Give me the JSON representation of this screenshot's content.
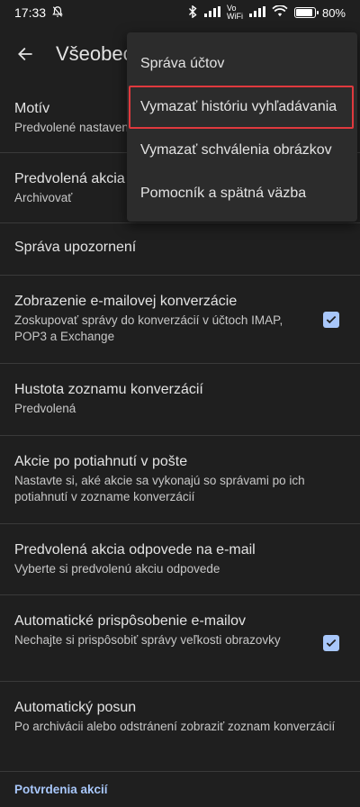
{
  "status_bar": {
    "time": "17:33",
    "network_top": "Vo",
    "network_bottom": "WiFi",
    "battery": "80%"
  },
  "header": {
    "title": "Všeobecné nastavenia"
  },
  "settings": [
    {
      "title": "Motív",
      "subtitle": "Predvolené nastavenie systému"
    },
    {
      "title": "Predvolená akcia upozornenia",
      "subtitle": "Archivovať"
    },
    {
      "title": "Správa upozornení"
    },
    {
      "title": "Zobrazenie e-mailovej konverzácie",
      "subtitle": "Zoskupovať správy do konverzácií v účtoch IMAP, POP3 a Exchange",
      "checked": true
    },
    {
      "title": "Hustota zoznamu konverzácií",
      "subtitle": "Predvolená"
    },
    {
      "title": "Akcie po potiahnutí v pošte",
      "subtitle": "Nastavte si, aké akcie sa vykonajú so správami po ich potiahnutí v zozname konverzácií"
    },
    {
      "title": "Predvolená akcia odpovede na e-mail",
      "subtitle": "Vyberte si predvolenú akciu odpovede"
    },
    {
      "title": "Automatické prispôsobenie e-mailov",
      "subtitle": "Nechajte si prispôsobiť správy veľkosti obrazovky",
      "checked": true
    },
    {
      "title": "Automatický posun",
      "subtitle": "Po archivácii alebo odstránení zobraziť zoznam konverzácií"
    }
  ],
  "section_header": "Potvrdenia akcií",
  "menu": {
    "items": [
      "Správa účtov",
      "Vymazať históriu vyhľadávania",
      "Vymazať schválenia obrázkov",
      "Pomocník a spätná väzba"
    ],
    "highlighted_index": 1
  },
  "colors": {
    "background": "#1f1f1f",
    "menu": "#2c2c2c",
    "accent": "#a8c7fa",
    "highlight": "#e0393e"
  }
}
